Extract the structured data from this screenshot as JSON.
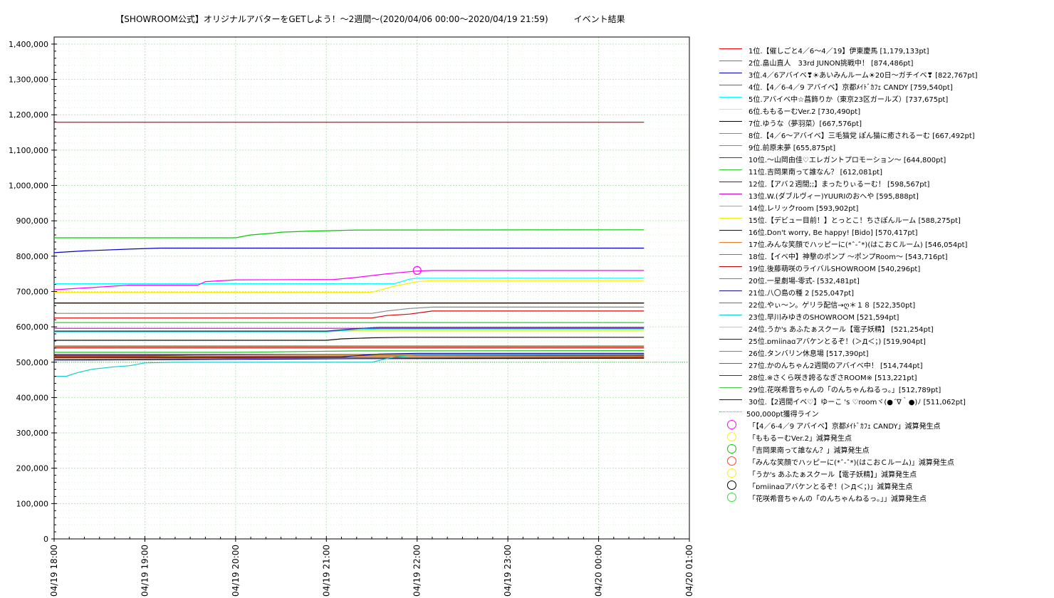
{
  "title": "【SHOWROOM公式】オリジナルアバターをGETしよう！〜2週間〜(2020/04/06 00:00〜2020/04/19 21:59)　　　イベント結果",
  "chart_data": {
    "type": "line",
    "xlabel": "",
    "ylabel": "",
    "ylim": [
      0,
      1420000
    ],
    "yticks": [
      0,
      100000,
      200000,
      300000,
      400000,
      500000,
      600000,
      700000,
      800000,
      900000,
      1000000,
      1100000,
      1200000,
      1300000,
      1400000
    ],
    "ytick_labels": [
      "0",
      "100,000",
      "200,000",
      "300,000",
      "400,000",
      "500,000",
      "600,000",
      "700,000",
      "800,000",
      "900,000",
      "1,000,000",
      "1,100,000",
      "1,200,000",
      "1,300,000",
      "1,400,000"
    ],
    "xlim": [
      0,
      420
    ],
    "xticks": [
      0,
      60,
      120,
      180,
      240,
      300,
      360,
      420
    ],
    "xtick_labels": [
      "04/19 18:00",
      "04/19 19:00",
      "04/19 20:00",
      "04/19 21:00",
      "04/19 22:00",
      "04/19 23:00",
      "04/20 00:00",
      "04/20 01:00"
    ],
    "x_units": "minutes from 04/19 18:00",
    "grid": true,
    "legend_position": "right",
    "series": [
      {
        "name": "1位.【催しごと4／6〜4／19】伊東慶馬 [1,179,133pt]",
        "color": "#ff0000",
        "points": [
          [
            0,
            1179133
          ],
          [
            390,
            1179133
          ]
        ]
      },
      {
        "name": "2位.畠山直人　33rd JUNON挑戦中！ [874,486pt]",
        "color": "#00cc00",
        "points": [
          [
            0,
            852000
          ],
          [
            120,
            852000
          ],
          [
            130,
            860000
          ],
          [
            145,
            865000
          ],
          [
            150,
            868000
          ],
          [
            170,
            871000
          ],
          [
            200,
            874000
          ],
          [
            390,
            874486
          ]
        ]
      },
      {
        "name": "3位.4／6アバイベ❣☀あいみんルーム☀20日〜ガチイベ❣ [822,767pt]",
        "color": "#0000cc",
        "points": [
          [
            0,
            810000
          ],
          [
            20,
            815000
          ],
          [
            50,
            820000
          ],
          [
            70,
            822767
          ],
          [
            390,
            822767
          ]
        ]
      },
      {
        "name": "4位.【4／6-4／9 アバイベ】京都ﾒｲﾄﾞｶﾌｪ CANDY [759,540pt]",
        "color": "#ff00ff",
        "points": [
          [
            0,
            705000
          ],
          [
            20,
            710000
          ],
          [
            50,
            718000
          ],
          [
            95,
            718000
          ],
          [
            100,
            728000
          ],
          [
            120,
            733000
          ],
          [
            185,
            734000
          ],
          [
            200,
            740000
          ],
          [
            220,
            750000
          ],
          [
            240,
            758000
          ],
          [
            250,
            759540
          ],
          [
            390,
            759540
          ]
        ]
      },
      {
        "name": "5位.アバイベ中☆菖飾りか（東京23区ガールズ）[737,675pt]",
        "color": "#00ffff",
        "points": [
          [
            0,
            722000
          ],
          [
            225,
            722000
          ],
          [
            235,
            735000
          ],
          [
            240,
            737675
          ],
          [
            390,
            737675
          ]
        ]
      },
      {
        "name": "6位.ももるーむVer.2 [730,490pt]",
        "color": "#ffee00",
        "points": [
          [
            0,
            698000
          ],
          [
            210,
            698000
          ],
          [
            225,
            715000
          ],
          [
            240,
            728000
          ],
          [
            250,
            730490
          ],
          [
            390,
            730490
          ]
        ]
      },
      {
        "name": "7位.ゆうな（夢羽菜）[667,576pt]",
        "color": "#000000",
        "points": [
          [
            0,
            667576
          ],
          [
            390,
            667576
          ]
        ]
      },
      {
        "name": "8位.【4／6〜アバイベ】三毛猫党 ぽん猫に癒されるーむ [667,492pt]",
        "color": "#ff6600",
        "points": [
          [
            0,
            667492
          ],
          [
            390,
            667492
          ]
        ]
      },
      {
        "name": "9位.前原未夢 [655,875pt]",
        "color": "#888888",
        "points": [
          [
            0,
            638000
          ],
          [
            210,
            638000
          ],
          [
            220,
            645000
          ],
          [
            235,
            652000
          ],
          [
            250,
            655875
          ],
          [
            390,
            655875
          ]
        ]
      },
      {
        "name": "10位.〜山岡由佳♡エレガントプロモーション〜 [644,800pt]",
        "color": "#dd0000",
        "points": [
          [
            0,
            625000
          ],
          [
            210,
            625000
          ],
          [
            220,
            632000
          ],
          [
            235,
            636000
          ],
          [
            250,
            644800
          ],
          [
            390,
            644800
          ]
        ]
      },
      {
        "name": "11位.吉岡果南って誰なん？ [612,081pt]",
        "color": "#33cc33",
        "points": [
          [
            0,
            612081
          ],
          [
            390,
            612081
          ]
        ]
      },
      {
        "name": "12位.【アバ２週間;;】まったりぃるーむ！ [598,567pt]",
        "color": "#2222aa",
        "points": [
          [
            0,
            588000
          ],
          [
            180,
            588000
          ],
          [
            200,
            595000
          ],
          [
            215,
            598567
          ],
          [
            390,
            598567
          ]
        ]
      },
      {
        "name": "13位.W.(ダブルヴィー)YUURIのおへや [595,888pt]",
        "color": "#cc00cc",
        "points": [
          [
            0,
            595888
          ],
          [
            390,
            595888
          ]
        ]
      },
      {
        "name": "14位.レリックroom [593,902pt]",
        "color": "#22dddd",
        "points": [
          [
            0,
            586000
          ],
          [
            180,
            586000
          ],
          [
            200,
            592000
          ],
          [
            215,
            593902
          ],
          [
            390,
            593902
          ]
        ]
      },
      {
        "name": "15位.【デビュー目前！】とっとこ！ちさぽんルーム [588,275pt]",
        "color": "#eeee00",
        "points": [
          [
            0,
            588275
          ],
          [
            390,
            588275
          ]
        ]
      },
      {
        "name": "16位.Don't worry, Be happy! [Bido] [570,417pt]",
        "color": "#111111",
        "points": [
          [
            0,
            562000
          ],
          [
            180,
            562000
          ],
          [
            190,
            566000
          ],
          [
            210,
            569000
          ],
          [
            230,
            570417
          ],
          [
            390,
            570417
          ]
        ]
      },
      {
        "name": "17位.みんな笑顔でハッピーに(*ˆ-ˆ*)(はこおＣルーム) [546,054pt]",
        "color": "#ee7722",
        "points": [
          [
            0,
            546054
          ],
          [
            390,
            546054
          ]
        ]
      },
      {
        "name": "18位.【イベ中】神撃のポンプ 〜ポンプRoom〜 [543,716pt]",
        "color": "#777777",
        "points": [
          [
            0,
            543716
          ],
          [
            390,
            543716
          ]
        ]
      },
      {
        "name": "19位.後藤萌咲のライバルSHOWROOM [540,296pt]",
        "color": "#cc0000",
        "points": [
          [
            0,
            540296
          ],
          [
            390,
            540296
          ]
        ]
      },
      {
        "name": "20位.一星劇場-零式- [532,481pt]",
        "color": "#22bb22",
        "points": [
          [
            0,
            528000
          ],
          [
            120,
            528000
          ],
          [
            200,
            532000
          ],
          [
            390,
            532481
          ]
        ]
      },
      {
        "name": "21位.八〇島の種 2 [525,047pt]",
        "color": "#111199",
        "points": [
          [
            0,
            515000
          ],
          [
            190,
            515000
          ],
          [
            215,
            523000
          ],
          [
            240,
            525047
          ],
          [
            390,
            525047
          ]
        ]
      },
      {
        "name": "22位.やぃ〜ン。ゲリラ配信→ღ＊１８ [522,350pt]",
        "color": "#dd22dd",
        "points": [
          [
            0,
            522350
          ],
          [
            390,
            522350
          ]
        ]
      },
      {
        "name": "23位.早川みゆきのSHOWROOM [521,594pt]",
        "color": "#11cccc",
        "points": [
          [
            0,
            460000
          ],
          [
            8,
            460000
          ],
          [
            15,
            470000
          ],
          [
            25,
            480000
          ],
          [
            40,
            487000
          ],
          [
            50,
            490000
          ],
          [
            60,
            498000
          ],
          [
            80,
            500000
          ],
          [
            200,
            500000
          ],
          [
            210,
            500000
          ],
          [
            215,
            505000
          ],
          [
            225,
            515000
          ],
          [
            240,
            520000
          ],
          [
            390,
            521594
          ]
        ]
      },
      {
        "name": "24位.うか's あふたぁスクール【電子妖精】 [521,254pt]",
        "color": "#dddd00",
        "points": [
          [
            0,
            515000
          ],
          [
            60,
            515000
          ],
          [
            90,
            518000
          ],
          [
            200,
            520000
          ],
          [
            390,
            521254
          ]
        ]
      },
      {
        "name": "25位.ɒmiinaɑアバケンとるぞ！(＞Д＜；) [519,904pt]",
        "color": "#222222",
        "points": [
          [
            0,
            519904
          ],
          [
            390,
            519904
          ]
        ]
      },
      {
        "name": "26位.タンバリン休息場 [517,390pt]",
        "color": "#dd6622",
        "points": [
          [
            0,
            517390
          ],
          [
            390,
            517390
          ]
        ]
      },
      {
        "name": "27位.かのんちゃん2週間のアバイベ中！ [514,744pt]",
        "color": "#666666",
        "points": [
          [
            0,
            509000
          ],
          [
            100,
            510000
          ],
          [
            200,
            513000
          ],
          [
            390,
            514744
          ]
        ]
      },
      {
        "name": "28位.※さくら咲き誇るなぎさROOM※ [513,221pt]",
        "color": "#bb0000",
        "points": [
          [
            0,
            513221
          ],
          [
            390,
            513221
          ]
        ]
      },
      {
        "name": "29位.花咲希音ちゃんの「のんちゃんねるっ。」[512,789pt]",
        "color": "#44cc44",
        "points": [
          [
            0,
            512789
          ],
          [
            390,
            512789
          ]
        ]
      },
      {
        "name": "30位.【2週間イベ♡】ゆーこ 's ♡roomヾ(●´∇｀●)ﾉ [511,062pt]",
        "color": "#0000aa",
        "points": [
          [
            0,
            506000
          ],
          [
            120,
            508000
          ],
          [
            200,
            510000
          ],
          [
            390,
            511062
          ]
        ]
      }
    ],
    "reference_line": {
      "name": "500,000pt獲得ライン",
      "value": 500000,
      "color": "#4caf50",
      "style": "dotted"
    },
    "markers": [
      {
        "name": "「【4／6-4／9 アバイベ】京都ﾒｲﾄﾞｶﾌｪ CANDY」減算発生点",
        "color": "#ff00ff",
        "x": 240,
        "y": 759540,
        "shown_on_plot": true
      },
      {
        "name": "「ももるーむVer.2」減算発生点",
        "color": "#ffee00",
        "shown_on_plot": false
      },
      {
        "name": "「吉岡果南って誰なん？」減算発生点",
        "color": "#00cc00",
        "shown_on_plot": false
      },
      {
        "name": "「みんな笑顔でハッピーに(*ˆ-ˆ*)(はこおＣルーム)」減算発生点",
        "color": "#ff4422",
        "shown_on_plot": false
      },
      {
        "name": "「うか's あふたぁスクール【電子妖精】」減算発生点",
        "color": "#ffee00",
        "shown_on_plot": false
      },
      {
        "name": "「ɒmiinaɑアバケンとるぞ！(＞Д＜；)」減算発生点",
        "color": "#000000",
        "shown_on_plot": false
      },
      {
        "name": "「花咲希音ちゃんの「のんちゃんねるっ。」」減算発生点",
        "color": "#33dd33",
        "shown_on_plot": false
      }
    ]
  }
}
